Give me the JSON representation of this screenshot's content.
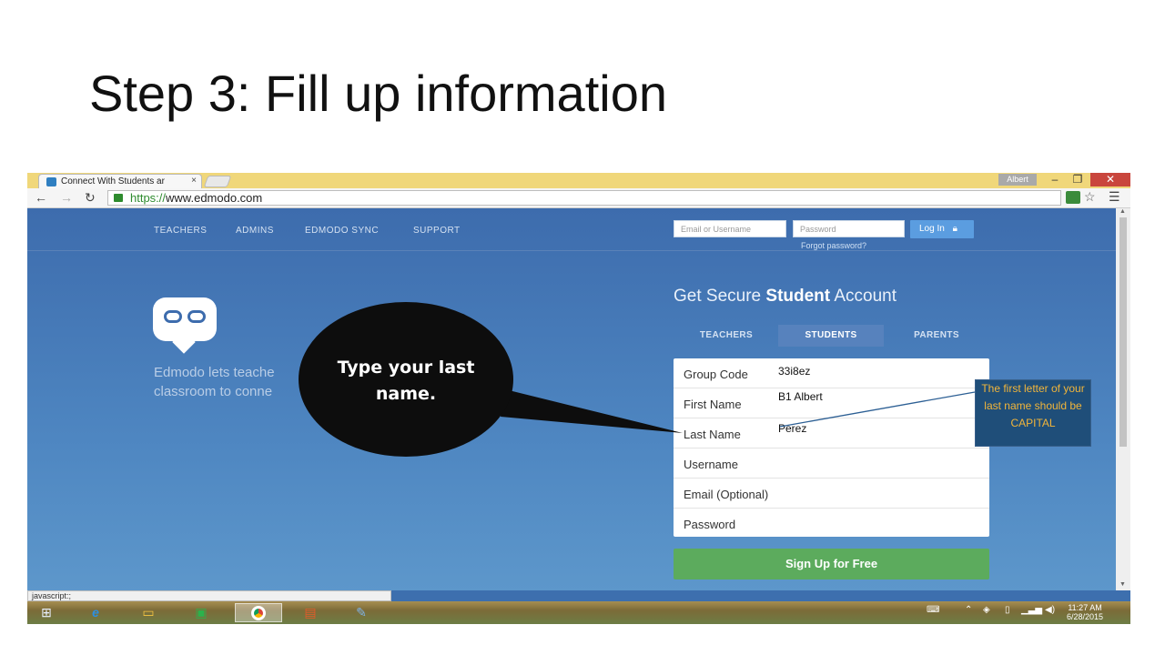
{
  "slide": {
    "title": "Step 3: Fill up information"
  },
  "browser": {
    "tab_title": "Connect With Students ar",
    "tab_close": "×",
    "user": "Albert",
    "url_scheme": "https://",
    "url_rest": "www.edmodo.com",
    "status_text": "javascript:;"
  },
  "site": {
    "nav": [
      "TEACHERS",
      "ADMINS",
      "EDMODO SYNC",
      "SUPPORT"
    ],
    "login": {
      "email_placeholder": "Email or Username",
      "password_placeholder": "Password",
      "button": "Log In",
      "forgot": "Forgot password?"
    },
    "tagline_line1": "Edmodo lets teache",
    "tagline_line2": "classroom to conne",
    "signup": {
      "title_pre": "Get Secure ",
      "title_bold": "Student",
      "title_post": " Account",
      "tabs": [
        "TEACHERS",
        "STUDENTS",
        "PARENTS"
      ],
      "active_tab": "STUDENTS",
      "fields": [
        {
          "label": "Group Code",
          "value": "33i8ez"
        },
        {
          "label": "First Name",
          "value": "B1 Albert"
        },
        {
          "label": "Last Name",
          "value": "Perez"
        },
        {
          "label": "Username",
          "value": ""
        },
        {
          "label": "Email (Optional)",
          "value": ""
        },
        {
          "label": "Password",
          "value": ""
        }
      ],
      "submit": "Sign Up for Free"
    }
  },
  "taskbar": {
    "clock_time": "11:27 AM",
    "clock_date": "6/28/2015"
  },
  "annotations": {
    "bubble_text": "Type your last name.",
    "note_text": "The first letter of your last name should be CAPITAL"
  },
  "colors": {
    "page_blue": "#3d6cad",
    "signup_green": "#5cab5d",
    "note_bg": "#1f4e79",
    "note_text": "#f2b53a",
    "close_red": "#c9463d"
  }
}
